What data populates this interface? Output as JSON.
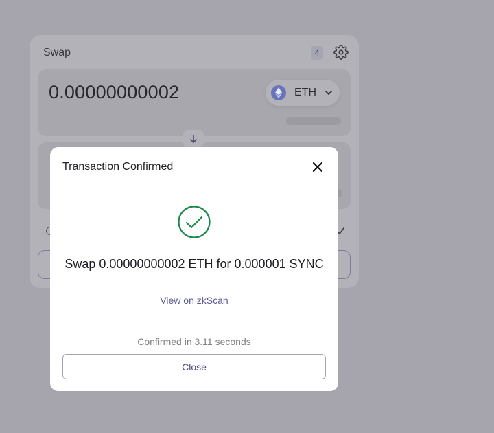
{
  "swap": {
    "title": "Swap",
    "pending_count": "4",
    "from_amount": "0.00000000002",
    "from_token": "ETH"
  },
  "modal": {
    "title": "Transaction Confirmed",
    "summary": "Swap 0.00000000002 ETH for 0.000001 SYNC",
    "explorer_link": "View on zkScan",
    "confirmed_text": "Confirmed in 3.11 seconds",
    "close_label": "Close"
  },
  "colors": {
    "success": "#1a8a4a",
    "link": "#595a94",
    "overlay": "#a6a5ad"
  },
  "icons": {
    "settings": "gear-icon",
    "token": "eth-logo-icon",
    "dropdown": "chevron-down-icon",
    "flip": "arrow-down-icon",
    "close": "close-icon",
    "success": "check-circle-icon"
  }
}
